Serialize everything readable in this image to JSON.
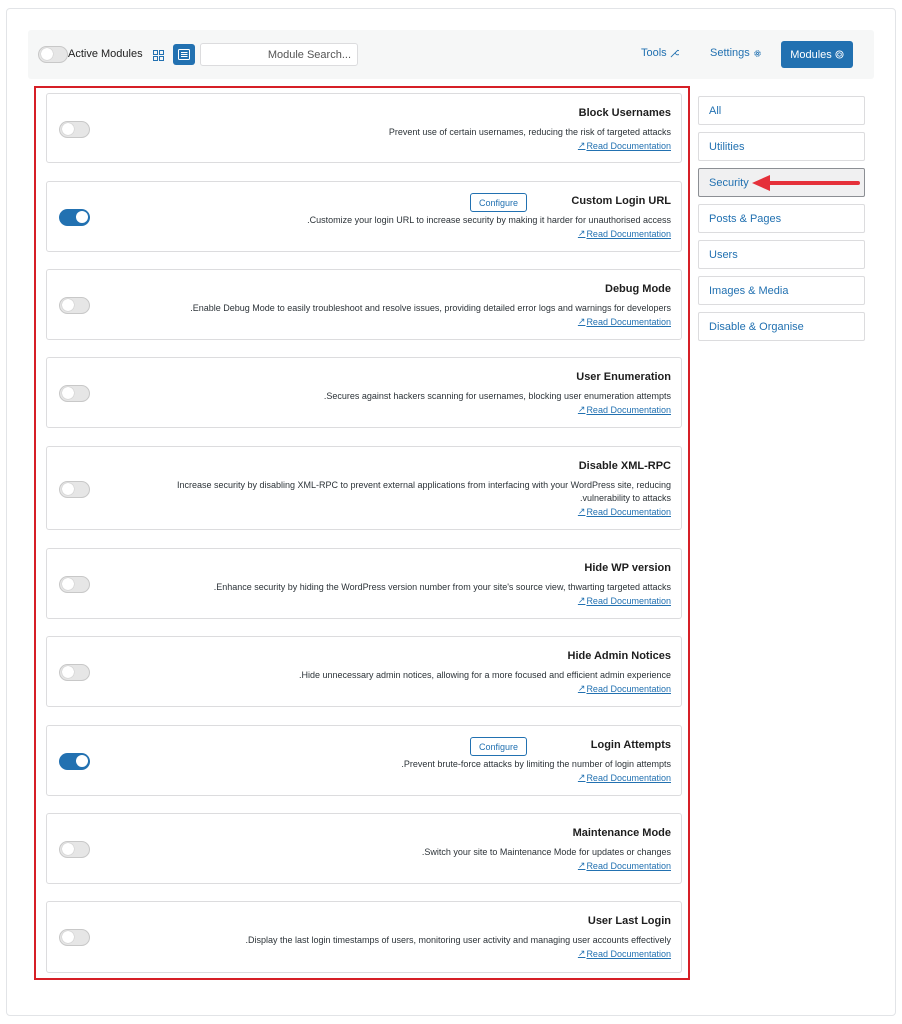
{
  "toolbar": {
    "active_modules_label": "Active Modules",
    "active_modules_on": false,
    "search_placeholder": "...Module Search",
    "nav": {
      "tools": "Tools",
      "settings": "Settings",
      "modules": "Modules"
    }
  },
  "modules": [
    {
      "title": "Block Usernames",
      "desc": [
        "Prevent use of certain usernames, reducing the risk of targeted attacks"
      ],
      "doc": "Read Documentation",
      "enabled": false,
      "configure": ""
    },
    {
      "title": "Custom Login URL",
      "desc": [
        ".Customize your login URL to increase security by making it harder for unauthorised access"
      ],
      "doc": "Read Documentation",
      "enabled": true,
      "configure": "Configure"
    },
    {
      "title": "Debug Mode",
      "desc": [
        ".Enable Debug Mode to easily troubleshoot and resolve issues, providing detailed error logs and warnings for developers"
      ],
      "doc": "Read Documentation",
      "enabled": false,
      "configure": ""
    },
    {
      "title": "User Enumeration",
      "desc": [
        ".Secures against hackers scanning for usernames, blocking user enumeration attempts"
      ],
      "doc": "Read Documentation",
      "enabled": false,
      "configure": ""
    },
    {
      "title": "Disable XML-RPC",
      "desc": [
        "Increase security by disabling XML-RPC to prevent external applications from interfacing with your WordPress site, reducing",
        ".vulnerability to attacks"
      ],
      "doc": "Read Documentation",
      "enabled": false,
      "configure": ""
    },
    {
      "title": "Hide WP version",
      "desc": [
        ".Enhance security by hiding the WordPress version number from your site's source view, thwarting targeted attacks"
      ],
      "doc": "Read Documentation",
      "enabled": false,
      "configure": ""
    },
    {
      "title": "Hide Admin Notices",
      "desc": [
        ".Hide unnecessary admin notices, allowing for a more focused and efficient admin experience"
      ],
      "doc": "Read Documentation",
      "enabled": false,
      "configure": ""
    },
    {
      "title": "Login Attempts",
      "desc": [
        ".Prevent brute-force attacks by limiting the number of login attempts"
      ],
      "doc": "Read Documentation",
      "enabled": true,
      "configure": "Configure"
    },
    {
      "title": "Maintenance Mode",
      "desc": [
        ".Switch your site to Maintenance Mode for updates or changes"
      ],
      "doc": "Read Documentation",
      "enabled": false,
      "configure": ""
    },
    {
      "title": "User Last Login",
      "desc": [
        ".Display the last login timestamps of users, monitoring user activity and managing user accounts effectively"
      ],
      "doc": "Read Documentation",
      "enabled": false,
      "configure": ""
    }
  ],
  "categories": [
    {
      "label": "All",
      "active": false
    },
    {
      "label": "Utilities",
      "active": false
    },
    {
      "label": "Security",
      "active": true
    },
    {
      "label": "Posts & Pages",
      "active": false
    },
    {
      "label": "Users",
      "active": false
    },
    {
      "label": "Images & Media",
      "active": false
    },
    {
      "label": "Disable & Organise",
      "active": false
    }
  ],
  "colors": {
    "accent": "#2271b1",
    "highlight_border": "#d61f26",
    "arrow": "#e5303a"
  },
  "icons": {
    "tools": "wrench-icon",
    "settings": "gear-icon",
    "modules": "cube-icon",
    "doc": "external-arrow-icon",
    "grid_view": "grid-view-icon",
    "list_view": "list-view-icon"
  }
}
